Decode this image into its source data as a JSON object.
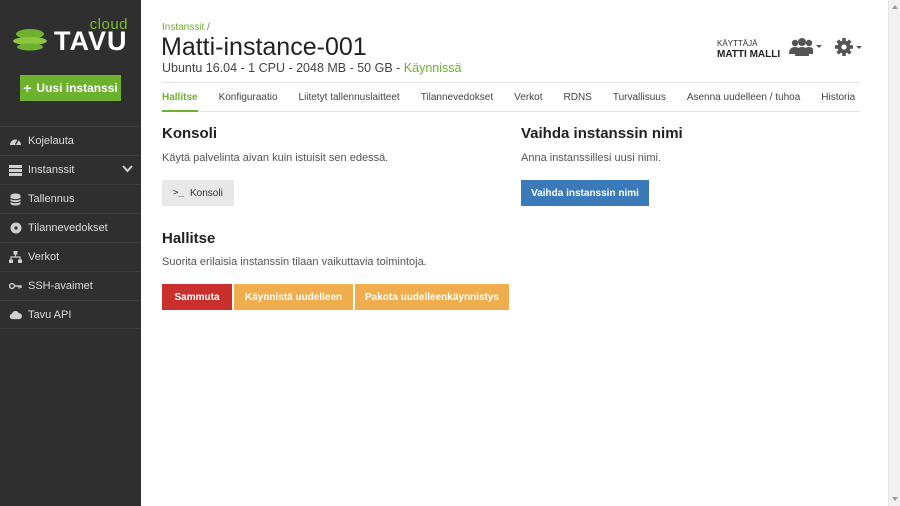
{
  "sidebar": {
    "logo_cloud": "cloud",
    "logo_brand": "TAVU",
    "new_instance_label": "Uusi instanssi",
    "items": [
      {
        "label": "Kojelauta",
        "icon": "dashboard-icon"
      },
      {
        "label": "Instanssit",
        "icon": "server-icon"
      },
      {
        "label": "Tallennus",
        "icon": "database-icon"
      },
      {
        "label": "Tilannevedokset",
        "icon": "disc-icon"
      },
      {
        "label": "Verkot",
        "icon": "network-icon"
      },
      {
        "label": "SSH-avaimet",
        "icon": "key-icon"
      },
      {
        "label": "Tavu API",
        "icon": "cloud-icon"
      }
    ]
  },
  "header": {
    "breadcrumb": "Instanssit",
    "breadcrumb_sep": "/",
    "title": "Matti-instance-001",
    "specs": "Ubuntu 16.04 - 1 CPU - 2048 MB - 50 GB - ",
    "status": "Käynnissä",
    "user_label": "KÄYTTÄJÄ",
    "user_name": "MATTI MALLI"
  },
  "tabs": [
    {
      "label": "Hallitse",
      "active": true
    },
    {
      "label": "Konfiguraatio"
    },
    {
      "label": "Liitetyt tallennuslaitteet"
    },
    {
      "label": "Tilannevedokset"
    },
    {
      "label": "Verkot"
    },
    {
      "label": "RDNS"
    },
    {
      "label": "Turvallisuus"
    },
    {
      "label": "Asenna uudelleen / tuhoa"
    },
    {
      "label": "Historia"
    }
  ],
  "console": {
    "title": "Konsoli",
    "desc": "Käytä palvelinta aivan kuin istuisit sen edessä.",
    "button": "Konsoli",
    "prompt": ">_"
  },
  "rename": {
    "title": "Vaihda instanssin nimi",
    "desc": "Anna instanssillesi uusi nimi.",
    "button": "Vaihda instanssin nimi"
  },
  "manage": {
    "title": "Hallitse",
    "desc": "Suorita erilaisia instanssin tilaan vaikuttavia toimintoja.",
    "stop": "Sammuta",
    "restart": "Käynnistä uudelleen",
    "force_restart": "Pakota uudelleenkäynnistys"
  },
  "colors": {
    "brand_green": "#6cb22c",
    "sidebar_bg": "#2f2f2f",
    "primary_blue": "#3a7ab8",
    "danger_red": "#c9302c",
    "warning_orange": "#f0ad4e"
  }
}
